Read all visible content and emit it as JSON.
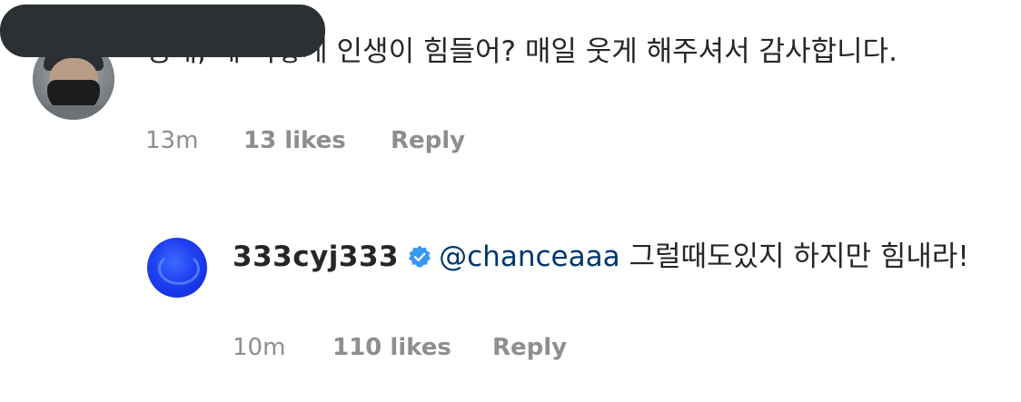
{
  "comment": {
    "text": "영재, 왜 이렇게 인생이 힘들어?  매일 웃게 해주셔서 감사합니다.",
    "time": "13m",
    "likes": "13 likes",
    "reply_label": "Reply"
  },
  "reply": {
    "username": "333cyj333",
    "verified_icon": "verified-badge-icon",
    "mention": "@chanceaaa",
    "text": " 그럴때도있지 하지만 힘내라!",
    "time": "10m",
    "likes": "110 likes",
    "reply_label": "Reply"
  },
  "colors": {
    "text": "#262626",
    "meta": "#8e8e8e",
    "mention": "#00376b",
    "verified": "#3897f0"
  }
}
